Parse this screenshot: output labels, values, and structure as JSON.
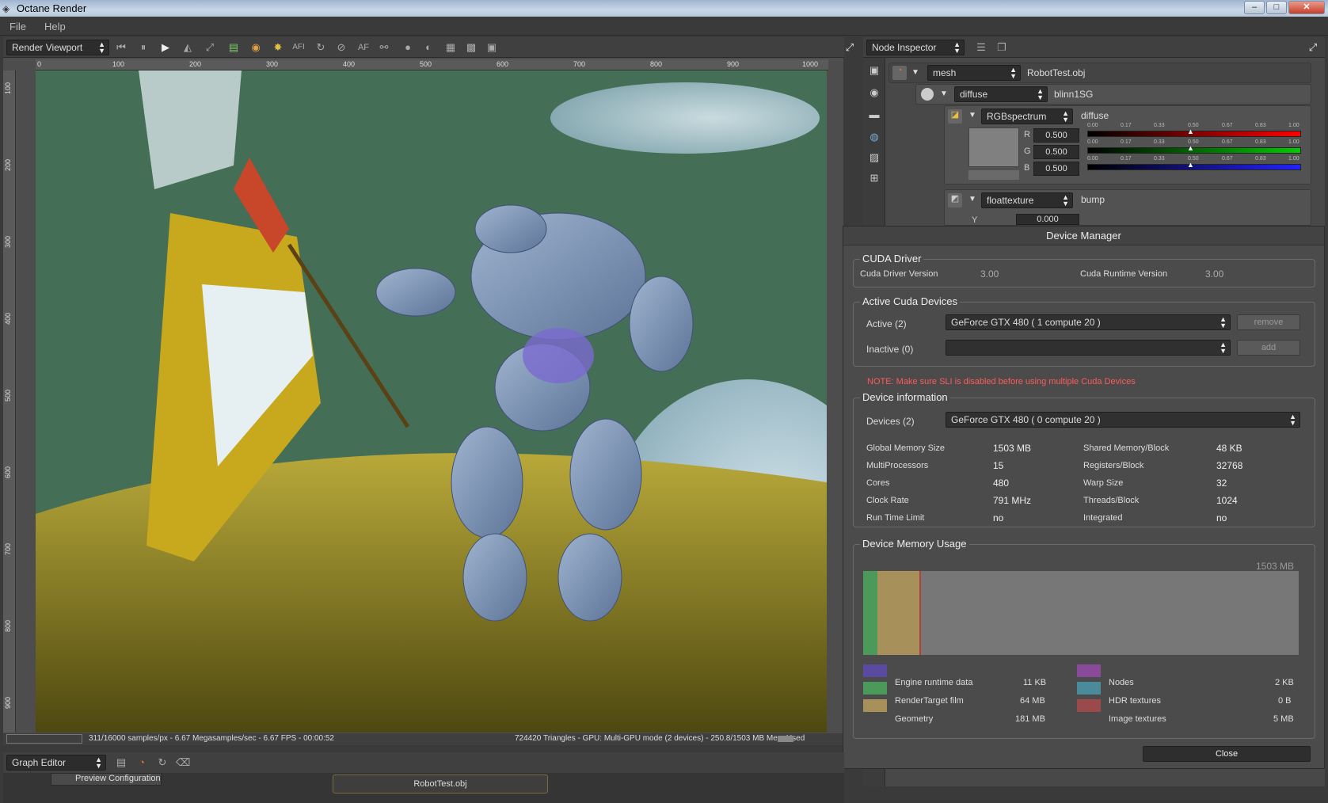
{
  "window": {
    "title": "Octane Render",
    "minimize": "–",
    "maximize": "□",
    "close": "✕"
  },
  "menu": {
    "items": [
      "File",
      "Help"
    ]
  },
  "viewport": {
    "panel_label": "Render Viewport",
    "toolbar_af": "AF",
    "toolbar_afi": "AFI",
    "ruler_h": [
      "0",
      "100",
      "200",
      "300",
      "400",
      "500",
      "600",
      "700",
      "800",
      "900",
      "1000"
    ],
    "ruler_v": [
      "100",
      "200",
      "300",
      "400",
      "500",
      "600",
      "700",
      "800",
      "900"
    ],
    "status_left": "311/16000 samples/px - 6.67 Megasamples/sec - 6.67 FPS - 00:00:52",
    "status_right": "724420 Triangles - GPU: Multi-GPU mode (2 devices) - 250.8/1503 MB Mem Used"
  },
  "node_inspector": {
    "panel_label": "Node Inspector",
    "mesh": {
      "type": "mesh",
      "name": "RobotTest.obj"
    },
    "material": {
      "type": "diffuse",
      "name": "blinn1SG"
    },
    "rgb": {
      "type": "RGBspectrum",
      "name": "diffuse",
      "r_label": "R",
      "g_label": "G",
      "b_label": "B",
      "r": "0.500",
      "g": "0.500",
      "b": "0.500"
    },
    "ticks": [
      "0.00",
      "0.17",
      "0.33",
      "0.50",
      "0.67",
      "0.83",
      "1.00"
    ],
    "float": {
      "type": "floattexture",
      "name": "bump",
      "y_label": "Y",
      "y": "0.000"
    }
  },
  "device_manager": {
    "title": "Device Manager",
    "cuda_driver": {
      "heading": "CUDA Driver",
      "driver_label": "Cuda Driver Version",
      "driver_value": "3.00",
      "runtime_label": "Cuda Runtime Version",
      "runtime_value": "3.00"
    },
    "active_devices": {
      "heading": "Active Cuda Devices",
      "active_label": "Active (2)",
      "active_value": "GeForce GTX 480 ( 1 compute 20 )",
      "remove": "remove",
      "inactive_label": "Inactive (0)",
      "inactive_value": "",
      "add": "add"
    },
    "note": "NOTE: Make sure SLI is disabled before using multiple Cuda Devices",
    "device_info": {
      "heading": "Device information",
      "devices_label": "Devices (2)",
      "devices_value": "GeForce GTX 480 ( 0 compute 20 )",
      "rows": [
        {
          "l1": "Global Memory Size",
          "v1": "1503 MB",
          "l2": "Shared Memory/Block",
          "v2": "48 KB"
        },
        {
          "l1": "MultiProcessors",
          "v1": "15",
          "l2": "Registers/Block",
          "v2": "32768"
        },
        {
          "l1": "Cores",
          "v1": "480",
          "l2": "Warp Size",
          "v2": "32"
        },
        {
          "l1": "Clock Rate",
          "v1": "791 MHz",
          "l2": "Threads/Block",
          "v2": "1024"
        },
        {
          "l1": "Run Time Limit",
          "v1": "no",
          "l2": "Integrated",
          "v2": "no"
        }
      ]
    },
    "memory": {
      "heading": "Device Memory Usage",
      "total": "1503 MB",
      "usage_fractions": {
        "green": 0.032,
        "tan": 0.1
      },
      "legend_left": [
        {
          "label": "",
          "value": "",
          "color": "#5a4aa0"
        },
        {
          "label": "Engine runtime data",
          "value": "11 KB",
          "color": "#4c9a5a"
        },
        {
          "label": "RenderTarget film",
          "value": "64 MB",
          "color": "#a8905a"
        },
        {
          "label": "Geometry",
          "value": "181 MB",
          "color": ""
        }
      ],
      "legend_right": [
        {
          "label": "",
          "value": "",
          "color": "#8a4a9a"
        },
        {
          "label": "Nodes",
          "value": "2 KB",
          "color": "#4a8a9a"
        },
        {
          "label": "HDR textures",
          "value": "0 B",
          "color": "#9a4a4a"
        },
        {
          "label": "Image textures",
          "value": "5 MB",
          "color": ""
        }
      ]
    },
    "close": "Close"
  },
  "graph_editor": {
    "panel_label": "Graph Editor",
    "preview": "Preview Configuration",
    "node": "RobotTest.obj"
  }
}
